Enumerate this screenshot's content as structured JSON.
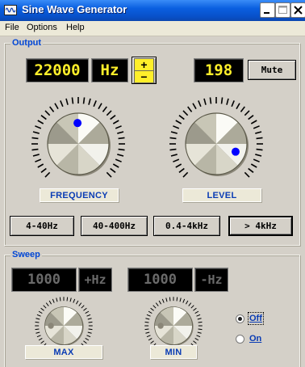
{
  "window": {
    "title": "Sine Wave Generator"
  },
  "menu": {
    "file": "File",
    "options": "Options",
    "help": "Help"
  },
  "output": {
    "group_label": "Output",
    "frequency_value": "22000",
    "frequency_unit": "Hz",
    "plus_symbol": "+",
    "minus_symbol": "−",
    "level_value": "198",
    "mute_label": "Mute",
    "frequency_label": "FREQUENCY",
    "level_label": "LEVEL",
    "ranges": [
      "4-40Hz",
      "40-400Hz",
      "0.4-4kHz",
      "> 4kHz"
    ]
  },
  "sweep": {
    "group_label": "Sweep",
    "plus_value": "1000",
    "plus_unit": "+Hz",
    "minus_value": "1000",
    "minus_unit": "-Hz",
    "max_label": "MAX",
    "min_label": "MIN",
    "off_label": "Off",
    "on_label": "On",
    "selected": "Off"
  },
  "colors": {
    "lcd_text": "#ffef2a",
    "label_text": "#0a3cb4",
    "group_text": "#0046d5",
    "indicator": "#0000ff"
  }
}
